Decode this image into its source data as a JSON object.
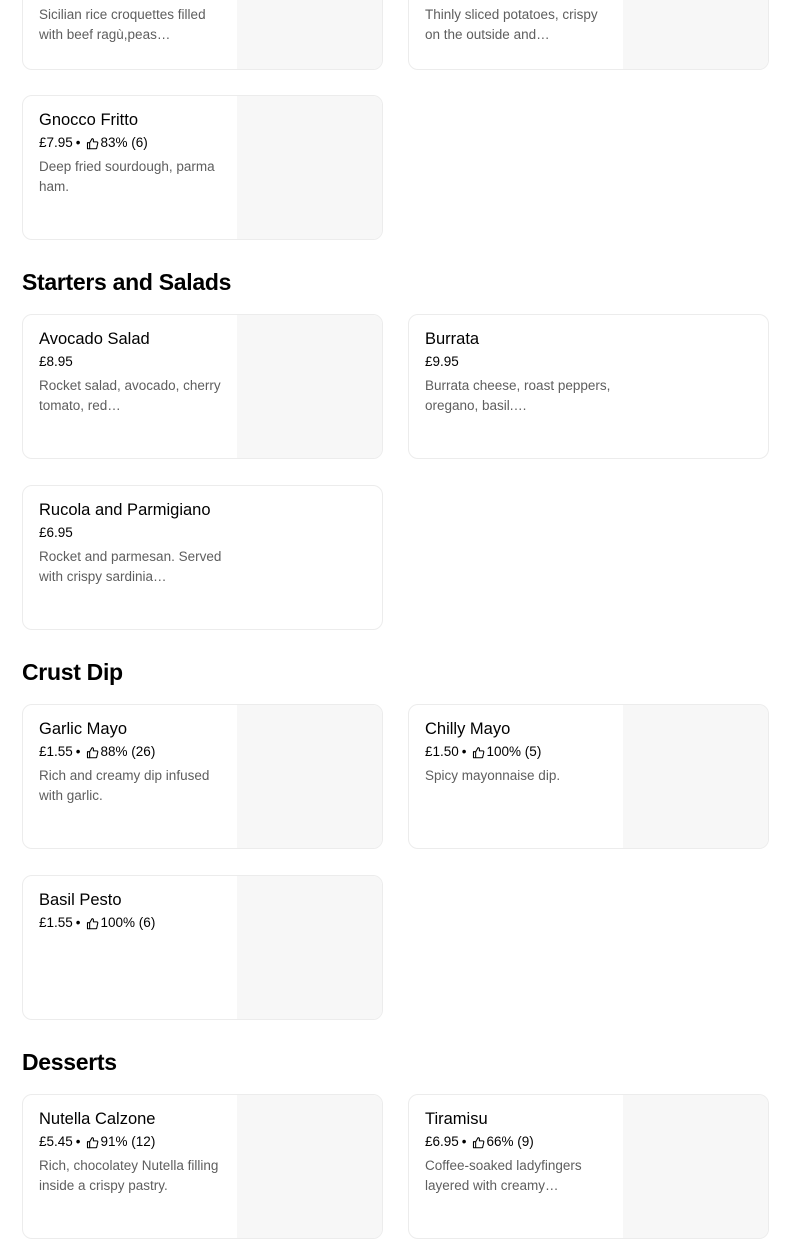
{
  "colors": {
    "card_border": "#ececec",
    "image_placeholder": "#f7f7f7",
    "description_text": "#5e5e5e"
  },
  "top_row": [
    {
      "name": "",
      "price": "",
      "desc": "Sicilian rice croquettes filled with beef ragù,peas…"
    },
    {
      "name": "",
      "price": "",
      "desc": "Thinly sliced potatoes, crispy on the outside and…"
    }
  ],
  "gnocco": {
    "name": "Gnocco Fritto",
    "price": "£7.95",
    "rating": "83% (6)",
    "desc": "Deep fried sourdough, parma ham."
  },
  "sections": {
    "starters": {
      "title": "Starters and Salads",
      "items": [
        {
          "name": "Avocado Salad",
          "price": "£8.95",
          "desc": "Rocket salad, avocado, cherry tomato, red…"
        },
        {
          "name": "Burrata",
          "price": "£9.95",
          "desc": "Burrata cheese, roast peppers, oregano, basil.…"
        },
        {
          "name": "Rucola and Parmigiano",
          "price": "£6.95",
          "desc": "Rocket and parmesan. Served with crispy sardinia…"
        }
      ]
    },
    "crust_dip": {
      "title": "Crust Dip",
      "items": [
        {
          "name": "Garlic Mayo",
          "price": "£1.55",
          "rating": "88% (26)",
          "desc": "Rich and creamy dip infused with garlic."
        },
        {
          "name": "Chilly Mayo",
          "price": "£1.50",
          "rating": "100% (5)",
          "desc": "Spicy mayonnaise dip."
        },
        {
          "name": "Basil Pesto",
          "price": "£1.55",
          "rating": "100% (6)",
          "desc": ""
        }
      ]
    },
    "desserts": {
      "title": "Desserts",
      "items": [
        {
          "name": "Nutella Calzone",
          "price": "£5.45",
          "rating": "91% (12)",
          "desc": "Rich, chocolatey Nutella filling inside a crispy pastry."
        },
        {
          "name": "Tiramisu",
          "price": "£6.95",
          "rating": "66% (9)",
          "desc": "Coffee-soaked ladyfingers layered with creamy…"
        }
      ]
    }
  },
  "icons": {
    "rating": "thumbs-up-icon"
  },
  "separator": "•"
}
